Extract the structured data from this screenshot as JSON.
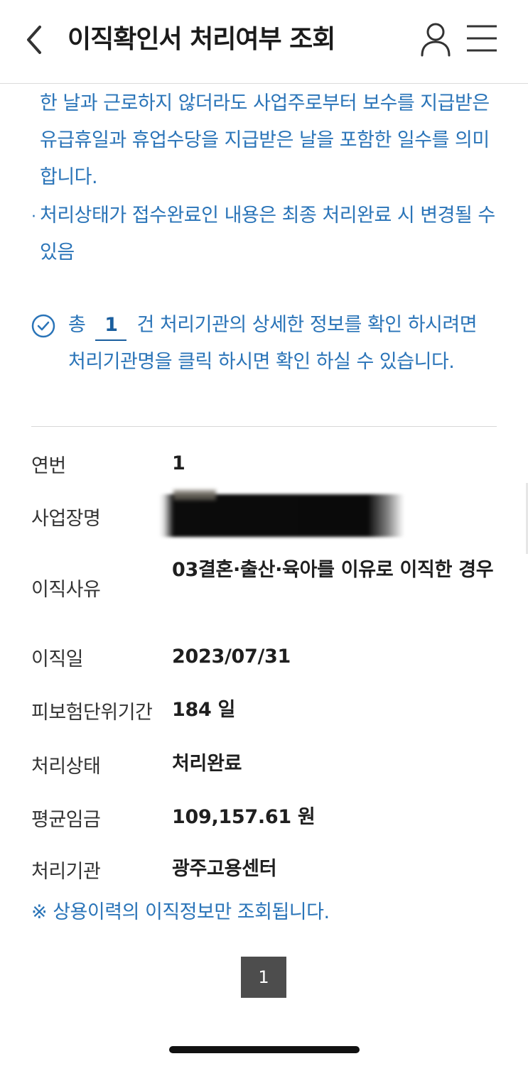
{
  "header": {
    "title": "이직확인서 처리여부 조회",
    "back_icon": "chevron-left-icon",
    "user_icon": "user-icon",
    "menu_icon": "hamburger-menu-icon"
  },
  "notes": {
    "line1": "한 날과 근로하지 않더라도 사업주로부터 보수를 지급받은 유급휴일과 휴업수당을 지급받은 날을 포함한 일수를 의미합니다.",
    "bullet": "·",
    "line2": "처리상태가 접수완료인 내용은 최종 처리완료 시 변경될 수 있음"
  },
  "info": {
    "prefix": "총",
    "count": "1",
    "suffix": "건 처리기관의 상세한 정보를 확인 하시려면 처리기관명을 클릭 하시면 확인 하실 수 있습니다."
  },
  "details": [
    {
      "label": "연번",
      "value": "1"
    },
    {
      "label": "사업장명",
      "value": ""
    },
    {
      "label": "이직사유",
      "value": "03결혼·출산·육아를 이유로 이직한 경우"
    },
    {
      "label": "이직일",
      "value": "2023/07/31"
    },
    {
      "label": "피보험단위기간",
      "value": "184 일"
    },
    {
      "label": "처리상태",
      "value": "처리완료"
    },
    {
      "label": "평균임금",
      "value": "109,157.61 원"
    },
    {
      "label": "처리기관",
      "value": "광주고용센터"
    }
  ],
  "footnote": "※ 상용이력의 이직정보만 조회됩니다.",
  "pagination": {
    "current_page": "1"
  },
  "colors": {
    "accent_blue": "#2a74b8",
    "pager_bg": "#4d4d4d"
  }
}
